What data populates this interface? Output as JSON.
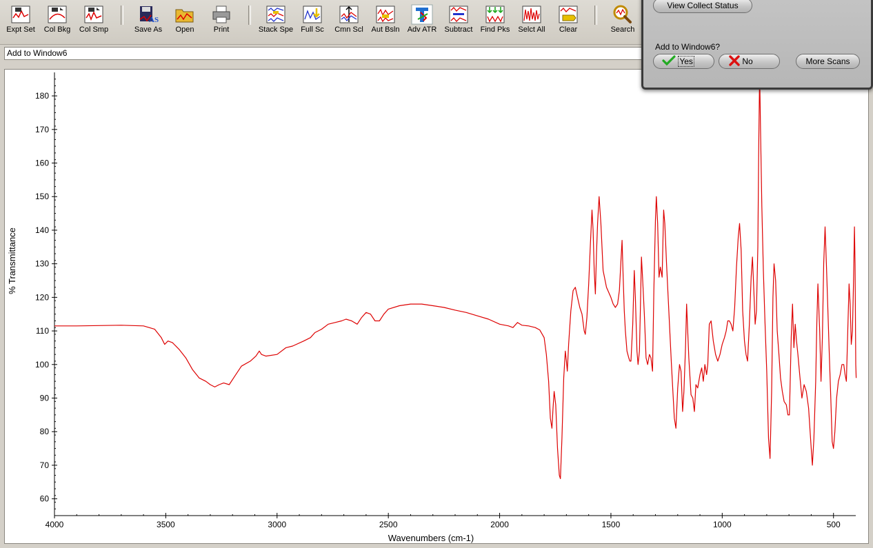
{
  "toolbar": {
    "buttons": [
      {
        "label": "Expt Set",
        "icon": "experiment-setup-icon"
      },
      {
        "label": "Col Bkg",
        "icon": "collect-background-icon"
      },
      {
        "label": "Col Smp",
        "icon": "collect-sample-icon"
      },
      {
        "label": "Save As",
        "icon": "save-as-icon"
      },
      {
        "label": "Open",
        "icon": "open-folder-icon"
      },
      {
        "label": "Print",
        "icon": "printer-icon"
      },
      {
        "label": "Stack Spe",
        "icon": "stack-spectra-icon"
      },
      {
        "label": "Full Sc",
        "icon": "full-scale-icon"
      },
      {
        "label": "Cmn Scl",
        "icon": "common-scale-icon"
      },
      {
        "label": "Aut Bsln",
        "icon": "auto-baseline-icon"
      },
      {
        "label": "Adv ATR",
        "icon": "advanced-atr-icon"
      },
      {
        "label": "Subtract",
        "icon": "subtract-icon"
      },
      {
        "label": "Find Pks",
        "icon": "find-peaks-icon"
      },
      {
        "label": "Selct All",
        "icon": "select-all-icon"
      },
      {
        "label": "Clear",
        "icon": "clear-icon"
      },
      {
        "label": "Search",
        "icon": "search-icon"
      }
    ]
  },
  "command_line": {
    "value": "Add to Window6"
  },
  "dialog": {
    "view_status_label": "View Collect Status",
    "question": "Add to Window6?",
    "yes_label": "Yes",
    "no_label": "No",
    "more_scans_label": "More Scans"
  },
  "colors": {
    "spectrum": "#dd0000",
    "background": "#d4d0c8",
    "yes_check": "#22aa22",
    "no_x": "#dd1111"
  },
  "chart_data": {
    "type": "line",
    "xlabel": "Wavenumbers (cm-1)",
    "ylabel": "% Transmittance",
    "xlim": [
      4000,
      400
    ],
    "x_reversed": true,
    "ylim": [
      55,
      187
    ],
    "xticks": [
      4000,
      3500,
      3000,
      2500,
      2000,
      1500,
      1000,
      500
    ],
    "yticks": [
      60,
      70,
      80,
      90,
      100,
      110,
      120,
      130,
      140,
      150,
      160,
      170,
      180
    ],
    "grid": false,
    "series": [
      {
        "name": "",
        "points": [
          [
            4000,
            111.5
          ],
          [
            3900,
            111.5
          ],
          [
            3800,
            111.6
          ],
          [
            3700,
            111.7
          ],
          [
            3600,
            111.5
          ],
          [
            3550,
            110.5
          ],
          [
            3520,
            108
          ],
          [
            3505,
            106
          ],
          [
            3490,
            107
          ],
          [
            3470,
            106.5
          ],
          [
            3440,
            104.5
          ],
          [
            3410,
            102
          ],
          [
            3380,
            98.5
          ],
          [
            3350,
            96
          ],
          [
            3320,
            95
          ],
          [
            3300,
            94
          ],
          [
            3280,
            93.3
          ],
          [
            3260,
            94
          ],
          [
            3240,
            94.5
          ],
          [
            3215,
            94
          ],
          [
            3190,
            96.5
          ],
          [
            3160,
            99.5
          ],
          [
            3120,
            101
          ],
          [
            3095,
            102.5
          ],
          [
            3080,
            104
          ],
          [
            3070,
            103
          ],
          [
            3050,
            102.5
          ],
          [
            3000,
            103
          ],
          [
            2960,
            105
          ],
          [
            2930,
            105.5
          ],
          [
            2880,
            107
          ],
          [
            2850,
            108
          ],
          [
            2830,
            109.5
          ],
          [
            2800,
            110.5
          ],
          [
            2770,
            112
          ],
          [
            2740,
            112.5
          ],
          [
            2710,
            113
          ],
          [
            2690,
            113.5
          ],
          [
            2665,
            113
          ],
          [
            2640,
            112
          ],
          [
            2620,
            114
          ],
          [
            2600,
            115.5
          ],
          [
            2580,
            115
          ],
          [
            2560,
            113
          ],
          [
            2540,
            113
          ],
          [
            2520,
            115
          ],
          [
            2500,
            116.5
          ],
          [
            2450,
            117.5
          ],
          [
            2400,
            118
          ],
          [
            2350,
            118
          ],
          [
            2300,
            117.5
          ],
          [
            2250,
            117
          ],
          [
            2200,
            116.2
          ],
          [
            2150,
            115.5
          ],
          [
            2100,
            114.5
          ],
          [
            2050,
            113.5
          ],
          [
            2000,
            112
          ],
          [
            1960,
            111.5
          ],
          [
            1940,
            111
          ],
          [
            1920,
            112.5
          ],
          [
            1900,
            111.7
          ],
          [
            1870,
            111.5
          ],
          [
            1840,
            111
          ],
          [
            1820,
            110.3
          ],
          [
            1800,
            108
          ],
          [
            1790,
            103
          ],
          [
            1780,
            95
          ],
          [
            1772,
            84
          ],
          [
            1765,
            81
          ],
          [
            1760,
            87
          ],
          [
            1755,
            92
          ],
          [
            1748,
            88
          ],
          [
            1740,
            75
          ],
          [
            1732,
            67
          ],
          [
            1727,
            66
          ],
          [
            1720,
            78
          ],
          [
            1712,
            96
          ],
          [
            1705,
            104
          ],
          [
            1700,
            101
          ],
          [
            1696,
            98
          ],
          [
            1690,
            106
          ],
          [
            1680,
            116
          ],
          [
            1670,
            122
          ],
          [
            1660,
            123
          ],
          [
            1650,
            120
          ],
          [
            1640,
            117
          ],
          [
            1630,
            115
          ],
          [
            1620,
            110
          ],
          [
            1615,
            109
          ],
          [
            1608,
            114
          ],
          [
            1600,
            124
          ],
          [
            1592,
            136
          ],
          [
            1585,
            146
          ],
          [
            1580,
            140
          ],
          [
            1575,
            128
          ],
          [
            1570,
            121
          ],
          [
            1565,
            133
          ],
          [
            1560,
            142
          ],
          [
            1553,
            150
          ],
          [
            1545,
            142
          ],
          [
            1535,
            128
          ],
          [
            1520,
            123
          ],
          [
            1500,
            120
          ],
          [
            1490,
            118
          ],
          [
            1480,
            117
          ],
          [
            1470,
            118
          ],
          [
            1462,
            122
          ],
          [
            1455,
            131
          ],
          [
            1450,
            137
          ],
          [
            1445,
            126
          ],
          [
            1440,
            116
          ],
          [
            1435,
            110
          ],
          [
            1428,
            104
          ],
          [
            1420,
            102
          ],
          [
            1415,
            101
          ],
          [
            1410,
            101
          ],
          [
            1402,
            112
          ],
          [
            1395,
            128
          ],
          [
            1390,
            120
          ],
          [
            1383,
            104
          ],
          [
            1378,
            100
          ],
          [
            1372,
            104
          ],
          [
            1368,
            116
          ],
          [
            1363,
            132
          ],
          [
            1358,
            126
          ],
          [
            1350,
            115
          ],
          [
            1342,
            102
          ],
          [
            1335,
            100
          ],
          [
            1327,
            103
          ],
          [
            1320,
            102
          ],
          [
            1313,
            98
          ],
          [
            1307,
            122
          ],
          [
            1300,
            143
          ],
          [
            1296,
            150
          ],
          [
            1290,
            142
          ],
          [
            1284,
            126
          ],
          [
            1278,
            129
          ],
          [
            1270,
            126
          ],
          [
            1263,
            146
          ],
          [
            1258,
            142
          ],
          [
            1250,
            130
          ],
          [
            1240,
            116
          ],
          [
            1228,
            100
          ],
          [
            1215,
            84
          ],
          [
            1208,
            81
          ],
          [
            1200,
            93
          ],
          [
            1192,
            100
          ],
          [
            1185,
            98
          ],
          [
            1178,
            86
          ],
          [
            1172,
            92
          ],
          [
            1165,
            105
          ],
          [
            1160,
            118
          ],
          [
            1150,
            102
          ],
          [
            1140,
            91
          ],
          [
            1132,
            90
          ],
          [
            1125,
            86
          ],
          [
            1118,
            94
          ],
          [
            1110,
            93
          ],
          [
            1100,
            97
          ],
          [
            1092,
            99
          ],
          [
            1085,
            95
          ],
          [
            1078,
            100
          ],
          [
            1070,
            97
          ],
          [
            1065,
            100
          ],
          [
            1058,
            112
          ],
          [
            1050,
            113
          ],
          [
            1040,
            107
          ],
          [
            1030,
            103
          ],
          [
            1020,
            101
          ],
          [
            1010,
            103
          ],
          [
            1000,
            106
          ],
          [
            990,
            108
          ],
          [
            982,
            110
          ],
          [
            975,
            113
          ],
          [
            968,
            113
          ],
          [
            960,
            112
          ],
          [
            952,
            110
          ],
          [
            944,
            117
          ],
          [
            936,
            129
          ],
          [
            928,
            138
          ],
          [
            922,
            142
          ],
          [
            915,
            134
          ],
          [
            908,
            116
          ],
          [
            900,
            107
          ],
          [
            893,
            103
          ],
          [
            886,
            101
          ],
          [
            878,
            112
          ],
          [
            870,
            126
          ],
          [
            864,
            132
          ],
          [
            858,
            122
          ],
          [
            852,
            112
          ],
          [
            846,
            116
          ],
          [
            840,
            135
          ],
          [
            836,
            165
          ],
          [
            832,
            187
          ],
          [
            828,
            170
          ],
          [
            822,
            147
          ],
          [
            815,
            128
          ],
          [
            808,
            113
          ],
          [
            800,
            98
          ],
          [
            792,
            78
          ],
          [
            785,
            72
          ],
          [
            778,
            92
          ],
          [
            772,
            120
          ],
          [
            767,
            130
          ],
          [
            760,
            125
          ],
          [
            753,
            110
          ],
          [
            745,
            103
          ],
          [
            738,
            96
          ],
          [
            730,
            92
          ],
          [
            722,
            89
          ],
          [
            712,
            88
          ],
          [
            705,
            85
          ],
          [
            698,
            85
          ],
          [
            690,
            108
          ],
          [
            684,
            118
          ],
          [
            678,
            105
          ],
          [
            672,
            112
          ],
          [
            666,
            107
          ],
          [
            660,
            103
          ],
          [
            652,
            97
          ],
          [
            642,
            90
          ],
          [
            632,
            94
          ],
          [
            622,
            92
          ],
          [
            612,
            87
          ],
          [
            600,
            75
          ],
          [
            595,
            70
          ],
          [
            588,
            78
          ],
          [
            580,
            95
          ],
          [
            575,
            112
          ],
          [
            570,
            124
          ],
          [
            562,
            110
          ],
          [
            556,
            95
          ],
          [
            550,
            108
          ],
          [
            544,
            130
          ],
          [
            538,
            141
          ],
          [
            532,
            130
          ],
          [
            526,
            118
          ],
          [
            520,
            105
          ],
          [
            512,
            90
          ],
          [
            506,
            77
          ],
          [
            500,
            75
          ],
          [
            494,
            80
          ],
          [
            486,
            90
          ],
          [
            478,
            95
          ],
          [
            470,
            97
          ],
          [
            462,
            100
          ],
          [
            454,
            100
          ],
          [
            448,
            97
          ],
          [
            442,
            95
          ],
          [
            436,
            110
          ],
          [
            430,
            124
          ],
          [
            425,
            118
          ],
          [
            420,
            106
          ],
          [
            415,
            110
          ],
          [
            410,
            125
          ],
          [
            406,
            141
          ],
          [
            403,
            130
          ],
          [
            400,
            100
          ],
          [
            398,
            96
          ]
        ]
      }
    ]
  }
}
